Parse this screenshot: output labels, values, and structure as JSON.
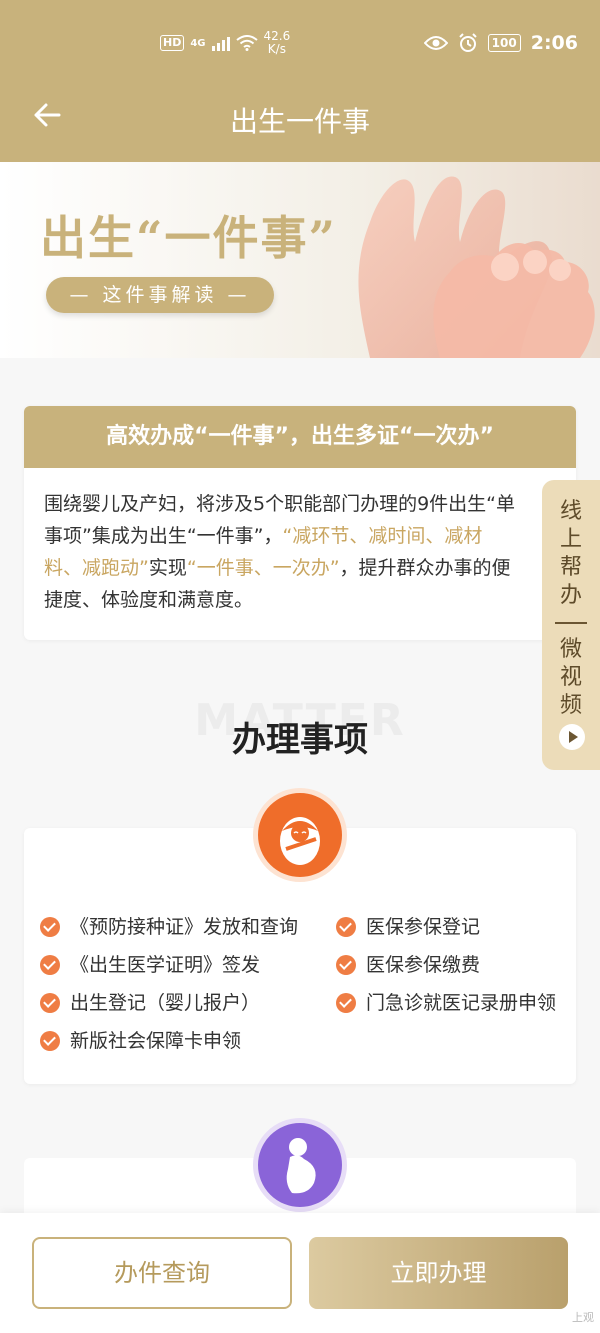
{
  "status_bar": {
    "hd": "HD",
    "network": "4G",
    "speed_value": "42.6",
    "speed_unit": "K/s",
    "battery": "100",
    "time": "2:06"
  },
  "nav": {
    "back_icon": "arrow-left-icon",
    "title": "出生一件事"
  },
  "banner": {
    "title": "出生“一件事”",
    "pill": "— 这件事解读 —"
  },
  "slogan": {
    "heading": "高效办成“一件事”，出生多证“一次办”",
    "body_1": "围绕婴儿及产妇，将涉及5个职能部门办理的9件出生“单",
    "body_2a": "事项”集成为出生“一件事”，",
    "body_2b": "“减环节、减时间、减材",
    "body_3a": "料、减跑动”",
    "body_3b": "实现",
    "body_3c": "“一件事、一次办”",
    "body_3d": "，提升群众办事的便",
    "body_4": "捷度、体验度和满意度。"
  },
  "float_tab": {
    "chars_1": [
      "线",
      "上",
      "帮",
      "办"
    ],
    "chars_2": [
      "微",
      "视",
      "频"
    ],
    "play_icon": "play-circle-icon"
  },
  "section": {
    "bg_text": "MATTER",
    "title": "办理事项"
  },
  "items_left": [
    "《预防接种证》发放和查询",
    "《出生医学证明》签发",
    "出生登记（婴儿报户）",
    "新版社会保障卡申领"
  ],
  "items_right": [
    "医保参保登记",
    "医保参保缴费",
    "门急诊就医记录册申领"
  ],
  "footer": {
    "query_label": "办件查询",
    "do_label": "立即办理",
    "watermark": "上观"
  },
  "colors": {
    "gold": "#c8b27c",
    "orange": "#ef6d2a",
    "purple": "#8a64d8"
  }
}
